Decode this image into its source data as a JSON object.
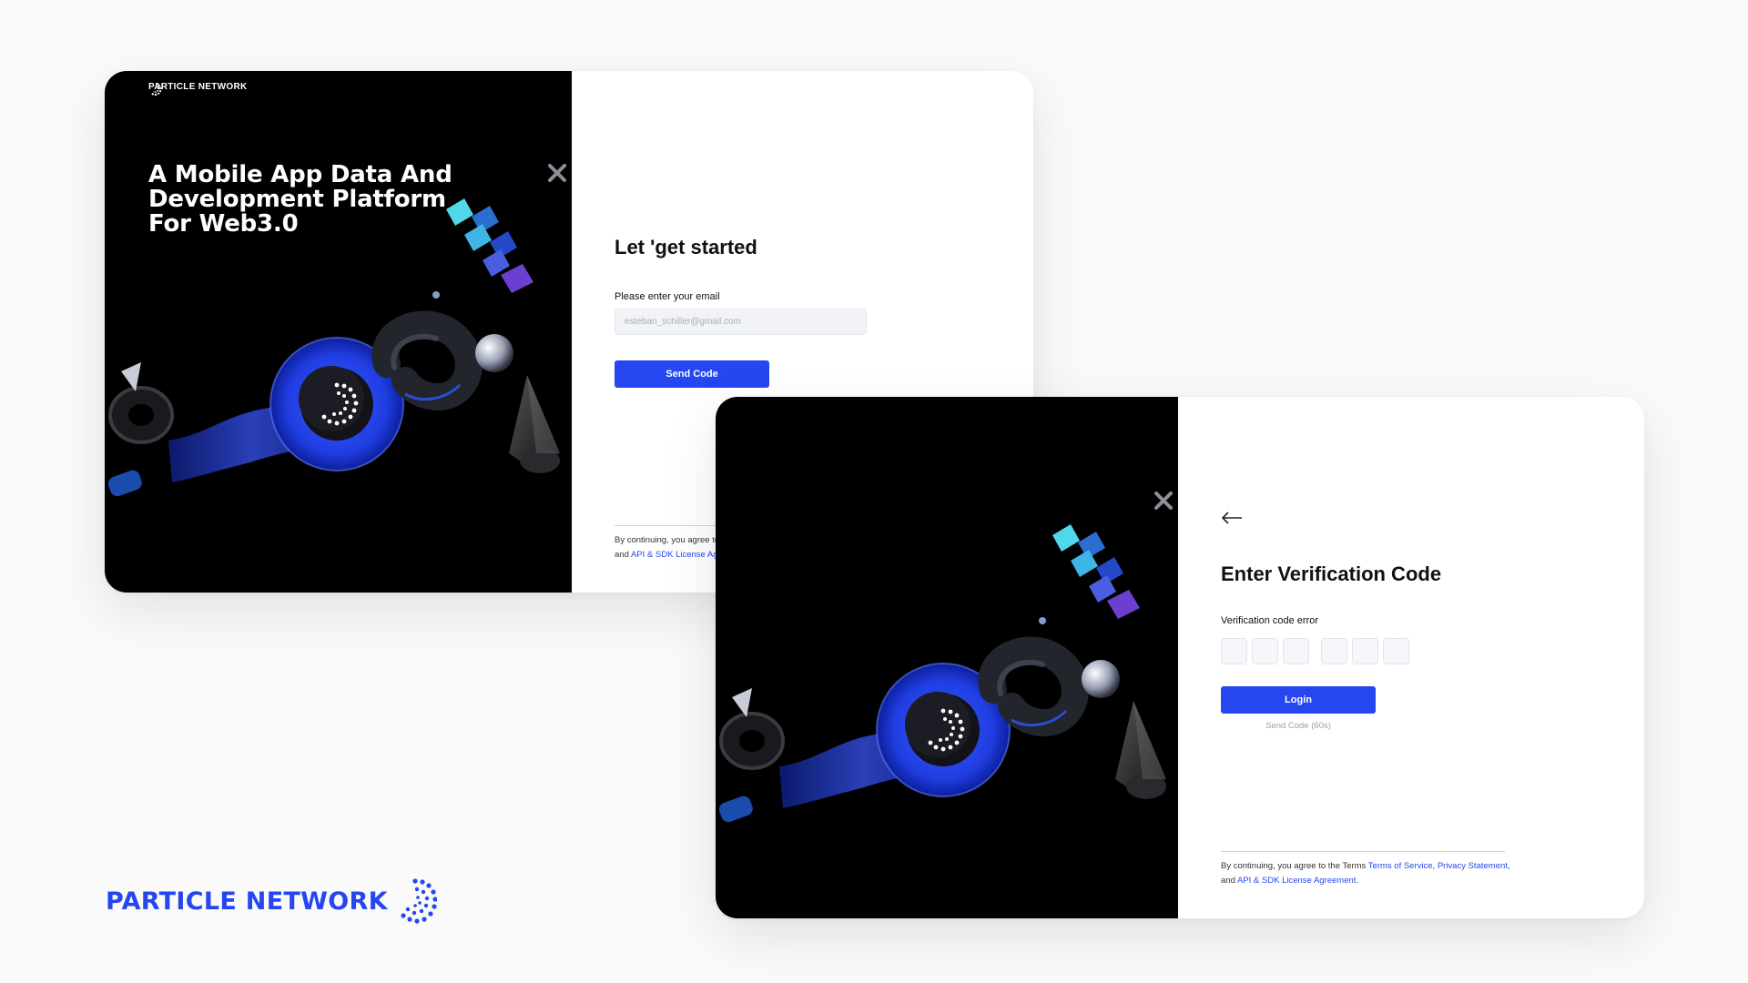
{
  "brand": {
    "name": "PARTICLE NETWORK",
    "color": "#2546f0"
  },
  "hero": {
    "headline": "A Mobile App Data And Development Platform For Web3.0"
  },
  "email_screen": {
    "title": "Let 'get started",
    "email_label": "Please enter your email",
    "email_placeholder": "esteban_schiller@gmail.com",
    "send_code_label": "Send Code"
  },
  "verify_screen": {
    "back_icon": "arrow-left-icon",
    "title": "Enter Verification Code",
    "error_label": "Verification code error",
    "code_digits": [
      "",
      "",
      "",
      "",
      "",
      ""
    ],
    "login_label": "Login",
    "resend_label": "Send Code (60s)"
  },
  "terms": {
    "prefix": "By continuing, you agree to the Terms ",
    "terms_link": "Terms of Service",
    "separator_1": ", ",
    "privacy_link": "Privacy Statement",
    "separator_2": ", and ",
    "api_link": "API & SDK License Agreement",
    "suffix": "."
  },
  "colors": {
    "accent": "#2546f0",
    "art_background": "#000000",
    "page_background": "#fafafa"
  }
}
